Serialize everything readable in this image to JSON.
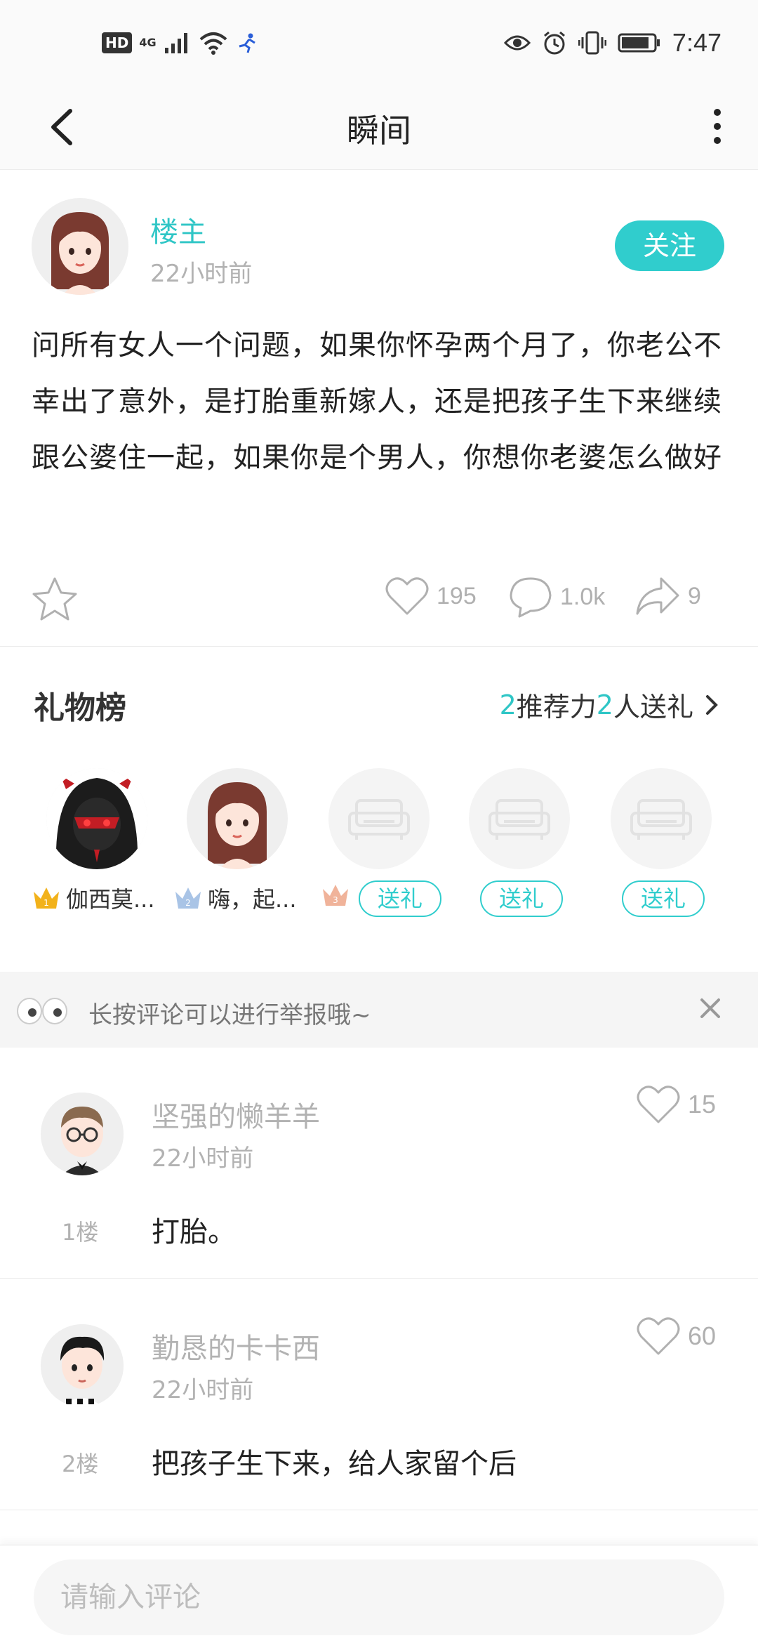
{
  "status_bar": {
    "hd": "HD",
    "network": "4G",
    "time": "7:47"
  },
  "header": {
    "title": "瞬间"
  },
  "post": {
    "author": "楼主",
    "time": "22小时前",
    "follow_label": "关注",
    "body": "问所有女人一个问题，如果你怀孕两个月了，你老公不幸出了意外，是打胎重新嫁人，还是把孩子生下来继续跟公婆住一起，如果你是个男人，你想你老婆怎么做好",
    "likes": "195",
    "comments": "1.0k",
    "shares": "9"
  },
  "gift_list": {
    "title": "礼物榜",
    "recommend_count": "2",
    "recommend_label": "推荐力",
    "sender_count": "2",
    "sender_label": "人送礼",
    "top": [
      {
        "rank": "1",
        "name": "伽西莫..."
      },
      {
        "rank": "2",
        "name": "嗨，起..."
      },
      {
        "rank": "3",
        "name": ""
      }
    ],
    "send_label": "送礼"
  },
  "tip": {
    "text": "长按评论可以进行举报哦~"
  },
  "comments": [
    {
      "name": "坚强的懒羊羊",
      "time": "22小时前",
      "floor": "1楼",
      "text": "打胎。",
      "likes": "15"
    },
    {
      "name": "勤恳的卡卡西",
      "time": "22小时前",
      "floor": "2楼",
      "text": "把孩子生下来，给人家留个后",
      "likes": "60"
    }
  ],
  "input": {
    "placeholder": "请输入评论"
  },
  "colors": {
    "accent": "#30cdcd",
    "gold": "#f2b21b",
    "silver": "#a9c4e6",
    "bronze": "#f0b39a"
  }
}
